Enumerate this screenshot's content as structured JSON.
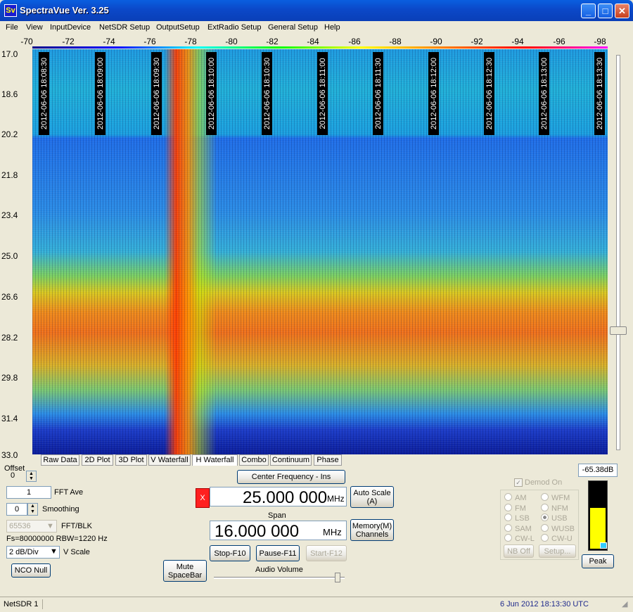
{
  "window": {
    "title": "SpectraVue Ver. 3.25",
    "icon_text": "Sv",
    "minimize": "_",
    "maximize": "□",
    "close": "✕"
  },
  "menu": [
    "File",
    "View",
    "InputDevice",
    "NetSDR Setup",
    "OutputSetup",
    "ExtRadio Setup",
    "General Setup",
    "Help"
  ],
  "freq_axis": [
    "-70",
    "-72",
    "-74",
    "-76",
    "-78",
    "-80",
    "-82",
    "-84",
    "-86",
    "-88",
    "-90",
    "-92",
    "-94",
    "-96",
    "-98"
  ],
  "time_axis": [
    "17.0",
    "18.6",
    "20.2",
    "21.8",
    "23.4",
    "25.0",
    "26.6",
    "28.2",
    "29.8",
    "31.4",
    "33.0"
  ],
  "timestamps": [
    "2012-06-06 18:08:30",
    "2012-06-06 18:09:00",
    "2012-06-06 18:09:30",
    "2012-06-06 18:10:00",
    "2012-06-06 18:10:30",
    "2012-06-06 18:11:00",
    "2012-06-06 18:11:30",
    "2012-06-06 18:12:00",
    "2012-06-06 18:12:30",
    "2012-06-06 18:13:00",
    "2012-06-06 18:13:30"
  ],
  "tabs": [
    "Raw Data",
    "2D Plot",
    "3D Plot",
    "V Waterfall",
    "H Waterfall",
    "Combo",
    "Continuum",
    "Phase"
  ],
  "active_tab": "H Waterfall",
  "controls": {
    "offset_label": "Offset",
    "offset_value": "0",
    "fft_ave_value": "1",
    "fft_ave_label": "FFT Ave",
    "smoothing_value": "0",
    "smoothing_label": "Smoothing",
    "fft_blk_value": "65536",
    "fft_blk_label": "FFT/BLK",
    "fs_info": "Fs=80000000 RBW=1220 Hz",
    "vscale_value": "2 dB/Div",
    "vscale_label": "V Scale",
    "nco_null": "NCO Null",
    "mute": "Mute\nSpaceBar",
    "center_freq_btn": "Center Frequency - Ins",
    "center_freq_value": "25.000 000",
    "unit_mhz": "MHz",
    "span_label": "Span",
    "span_value": "16.000 000",
    "auto_scale": "Auto Scale\n(A)",
    "memory": "Memory(M)\nChannels",
    "stop": "Stop-F10",
    "pause": "Pause-F11",
    "start": "Start-F12",
    "audio_volume": "Audio Volume",
    "x_mark": "X"
  },
  "demod": {
    "label": "Demod On",
    "modes": [
      "AM",
      "WFM",
      "FM",
      "NFM",
      "LSB",
      "USB",
      "SAM",
      "WUSB",
      "CW-L",
      "CW-U"
    ],
    "selected": "USB",
    "nb_off": "NB Off",
    "setup": "Setup..."
  },
  "meter": {
    "reading": "-65.38dB",
    "peak": "Peak",
    "level": 0.62
  },
  "status": {
    "left": "NetSDR 1",
    "right": "6 Jun 2012  18:13:30 UTC"
  },
  "colors": {
    "title_blue": "#0b48c8",
    "x_red": "#ff2020",
    "status_date": "#1f2a8c"
  }
}
